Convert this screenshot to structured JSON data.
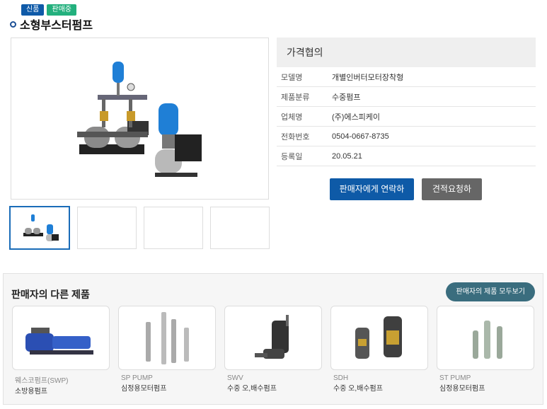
{
  "badges": {
    "new": "신품",
    "sale": "판매중"
  },
  "product": {
    "title": "소형부스터펌프"
  },
  "price_label": "가격협의",
  "specs": [
    {
      "label": "모델명",
      "value": "개별인버터모터장착형"
    },
    {
      "label": "제품분류",
      "value": "수중펌프"
    },
    {
      "label": "업체명",
      "value": "(주)에스피케이"
    },
    {
      "label": "전화번호",
      "value": "0504-0667-8735"
    },
    {
      "label": "등록일",
      "value": "20.05.21"
    }
  ],
  "buttons": {
    "contact": "판매자에게 연락하기",
    "quote": "견적요청하기"
  },
  "other_products": {
    "title": "판매자의 다른 제품",
    "view_all": "판매자의 제품 모두보기",
    "items": [
      {
        "sub": "웨스코펌프(SWP)",
        "name": "소방용펌프"
      },
      {
        "sub": "SP PUMP",
        "name": "심정용모터펌프"
      },
      {
        "sub": "SWV",
        "name": "수중 오,배수펌프"
      },
      {
        "sub": "SDH",
        "name": "수중 오,배수펌프"
      },
      {
        "sub": "ST PUMP",
        "name": "심정용모터펌프"
      }
    ]
  },
  "colors": {
    "accent": "#0e5aa7",
    "badge_new": "#0f5aa8",
    "badge_sale": "#23b07d",
    "view_all_bg": "#3a6d7e"
  }
}
